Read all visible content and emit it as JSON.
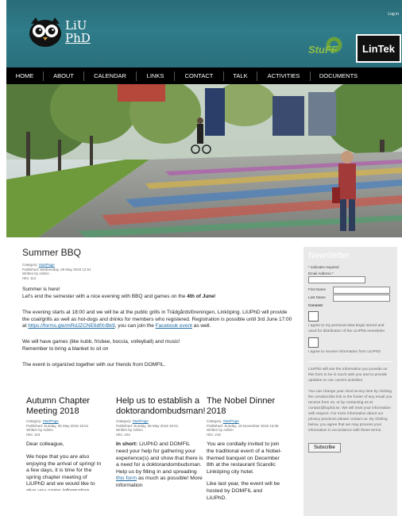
{
  "header": {
    "login_label": "Log in",
    "logo_line1": "LiU",
    "logo_line2": "PhD",
    "sponsor1": "StuFF",
    "sponsor2": "LinTek"
  },
  "nav": {
    "items": [
      "HOME",
      "ABOUT",
      "CALENDAR",
      "LINKS",
      "CONTACT",
      "TALK",
      "ACTIVITIES",
      "DOCUMENTS"
    ]
  },
  "article": {
    "title": "Summer BBQ",
    "category_prefix": "Category: ",
    "category": "StartPage",
    "published": "Published: Wednesday, 29 May 2019 12:51",
    "written_by": "Written by Admin",
    "hits": "Hits: 112",
    "p1_line1": "Summer is here!",
    "p1_line2_start": "Let's end the semester with a nice evening with BBQ and games on the ",
    "p1_line2_bold": "4th of June",
    "p1_line2_end": "!",
    "p2_start": "The evening starts at 18:00 and we will be at the public grills in Trädgårdsföreningen, Linköping. LiUPhD will provide the coal/grills as well as hot-dogs and drinks for members who registered. Registration is possible until 3rd June 17:00 at ",
    "p2_link": "https://forms.gle/mRdJZCNE6dfXrBk9",
    "p2_mid": ", you can join the ",
    "p2_link2": "Facebook event",
    "p2_end": " as well.",
    "p3_line1": "We will have games (like kubb, frisbee, boccia, volleyball) and music!",
    "p3_line2": "Remember to bring a blanket to sit on",
    "p4": "The event is organized together with our friends from DOMFIL."
  },
  "columns": [
    {
      "title": "Autumn Chapter Meeting 2018",
      "category": "StartPage",
      "published": "Published: Sunday, 05 May 2019 15:01",
      "written_by": "Written by Admin",
      "hits": "Hits: 115",
      "p1": "Dear colleague,",
      "p2": "We hope that you are also enjoying the arrival of spring! In a few days, it is time for the spring chapter meeting of LiUPhD and we would like to give you some information"
    },
    {
      "title": "Help us to establish a doktorandombudsman!",
      "category": "StartPage",
      "published": "Published: Sunday, 05 May 2019 15:01",
      "written_by": "Written by Admin",
      "hits": "Hits: 104",
      "p1_bold": "In short:",
      "p1_start": " LiUPhD and DOMFIL need your help for gathering your experience(s) and show that there is a need for a doktorandombudsman. Help us by filling in and spreading ",
      "p1_link": "this form",
      "p1_end": " as much as possible! More information"
    },
    {
      "title": "The Nobel Dinner 2018",
      "category": "StartPage",
      "published": "Published: Sunday, 18 November 2018 16:08",
      "written_by": "Written by Admin",
      "hits": "Hits: 219",
      "p1": "You are cordially invited to join the traditional event of a Nobel-themed banquet on December 8th at the restaurant Scandic Linköping city hotel.",
      "p2": "Like last year, the event will be hosted by DOMFIL and LiUPhD."
    }
  ],
  "sidebar": {
    "title": "Newsletter",
    "required_note": "* indicates required",
    "email_label": "Email Address *",
    "first_name_label": "First Name",
    "last_name_label": "Last Name",
    "consent_label": "Consent",
    "consent1": "I agree to my personal data begin stored and used for distribution of the LiUPhD newsletter",
    "consent2": "I agree to receive information from LiUPhD",
    "info1": "LiUPhD will use the information you provide on this form to be in touch with you and to provide updates on our current activities.",
    "info2": "You can change your mind at any time by clicking the unsubscribe link in the footer of any email you receive from us, or by contacting us at contact@liuphd.se. We will treat your information with respect. For more information about our privacy practices please contact us. By clicking below, you agree that we may process your information in accordance with these terms.",
    "subscribe_label": "Subscribe"
  },
  "colors": {
    "header_teal": "#2f7c8a",
    "nav_black": "#000000",
    "link_blue": "#1c6ba3",
    "sidebar_bg": "#e9e9e9"
  }
}
